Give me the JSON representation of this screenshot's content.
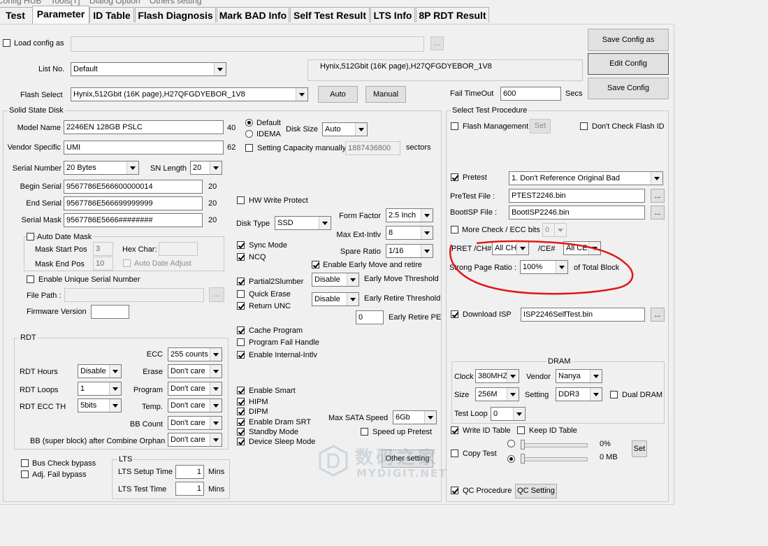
{
  "menubar": {
    "items": [
      "Config HUB",
      "Tools[T]",
      "Dialog Option",
      "Others setting"
    ]
  },
  "tabs": [
    "Test",
    "Parameter",
    "ID Table",
    "Flash Diagnosis",
    "Mark BAD Info",
    "Self Test Result",
    "LTS Info",
    "8P RDT Result"
  ],
  "top": {
    "load_config_label": "Load config as",
    "load_config_path": "",
    "browse_label": "...",
    "list_no_label": "List No.",
    "list_no_value": "Default",
    "flash_info": "Hynix,512Gbit (16K page),H27QFGDYEBOR_1V8",
    "flash_select_label": "Flash Select",
    "flash_select_value": "Hynix,512Gbit (16K page),H27QFGDYEBOR_1V8",
    "auto_label": "Auto",
    "manual_label": "Manual",
    "save_config_as": "Save Config as",
    "edit_config": "Edit Config",
    "save_config": "Save Config",
    "fail_timeout_label": "Fail TimeOut",
    "fail_timeout_value": "600",
    "secs_label": "Secs"
  },
  "ssd": {
    "title": "Solid State Disk",
    "model_name_label": "Model Name",
    "model_name": "2246EN 128GB PSLC",
    "model_len": "40",
    "vendor_label": "Vendor Specific",
    "vendor": "UMI",
    "vendor_len": "62",
    "default_label": "Default",
    "idema_label": "IDEMA",
    "disk_size_label": "Disk Size",
    "disk_size": "Auto",
    "set_capacity_label": "Setting Capacity manually",
    "capacity": "1887436800",
    "sectors_label": "sectors",
    "serial_num_label": "Serial Number",
    "serial_num": "20 Bytes",
    "sn_length_label": "SN Length",
    "sn_length": "20",
    "begin_serial_label": "Begin Serial",
    "begin_serial": "9567786E566600000014",
    "begin_len": "20",
    "end_serial_label": "End Serial",
    "end_serial": "9567786E566699999999",
    "end_len": "20",
    "serial_mask_label": "Serial Mask",
    "serial_mask": "9567786E5666########",
    "mask_len": "20",
    "auto_date_mask_label": "Auto Date Mask",
    "mask_start_label": "Mask Start Pos",
    "mask_start": "3",
    "mask_end_label": "Mask End Pos",
    "mask_end": "10",
    "hex_char_label": "Hex Char:",
    "hex_char": "",
    "auto_date_adjust_label": "Auto Date Adjust",
    "unique_serial_label": "Enable Unique Serial Number",
    "file_path_label": "File Path :",
    "file_path": "",
    "firmware_label": "Firmware Version",
    "firmware": "",
    "hw_write_protect": "HW Write Protect",
    "disk_type_label": "Disk Type",
    "disk_type": "SSD",
    "form_factor_label": "Form Factor",
    "form_factor": "2.5 Inch",
    "max_ext_label": "Max Ext-Intlv",
    "max_ext": "8",
    "spare_ratio_label": "Spare Ratio",
    "spare_ratio": "1/16",
    "sync_mode": "Sync Mode",
    "ncq": "NCQ",
    "early_move_retire": "Enable Early Move and retire",
    "partial2slumber": "Partial2Slumber",
    "quick_erase": "Quick Erase",
    "return_unc": "Return UNC",
    "early_move_sel": "Disable",
    "early_move_label": "Early Move Threshold",
    "early_retire_sel": "Disable",
    "early_retire_label": "Early Retire Threshold",
    "early_retire_pe": "0",
    "early_retire_pe_label": "Early Retire PE",
    "cache_program": "Cache Program",
    "program_fail_handle": "Program Fail Handle",
    "enable_internal_intlv": "Enable Internal-Intlv",
    "enable_smart": "Enable Smart",
    "hipm": "HIPM",
    "dipm": "DIPM",
    "enable_dram_srt": "Enable Dram SRT",
    "standby_mode": "Standby Mode",
    "device_sleep_mode": "Device Sleep Mode",
    "max_sata_label": "Max SATA Speed",
    "max_sata": "6Gb",
    "speed_up_pretest": "Speed up Pretest",
    "other_setting": "Other setting"
  },
  "rdt": {
    "title": "RDT",
    "ecc_label": "ECC",
    "ecc": "255 counts",
    "hours_label": "RDT Hours",
    "hours": "Disable",
    "erase_label": "Erase",
    "erase": "Don't care",
    "loops_label": "RDT Loops",
    "loops": "1",
    "program_label": "Program",
    "program": "Don't care",
    "ecc_th_label": "RDT ECC TH",
    "ecc_th": "5bits",
    "temp_label": "Temp.",
    "temp": "Don't care",
    "bb_count_label": "BB Count",
    "bb_count": "Don't care",
    "bb_super_label": "BB (super block) after Combine Orphan",
    "bb_super": "Don't care"
  },
  "misc": {
    "bus_check_bypass": "Bus Check bypass",
    "adj_fail_bypass": "Adj. Fail bypass"
  },
  "lts": {
    "title": "LTS",
    "setup_label": "LTS Setup Time",
    "setup": "1",
    "test_label": "LTS Test Time",
    "test": "1",
    "mins": "Mins"
  },
  "procedure": {
    "title": "Select Test Procedure",
    "flash_mgmt": "Flash Management",
    "set_label": "Set",
    "dont_check_flash_id": "Don't Check Flash ID",
    "pretest": "Pretest",
    "pretest_mode": "1. Don't Reference Original Bad",
    "pretest_file_label": "PreTest File :",
    "pretest_file": "PTEST2246.bin",
    "bootisp_label": "BootISP File :",
    "bootisp": "BootISP2246.bin",
    "more_check": "More Check / ECC bits",
    "more_check_val": "0",
    "pret_ch_label": "PRET /CH#",
    "pret_ch": "All CH",
    "ce_label": "/CE#",
    "ce": "All CE",
    "strong_ratio_label": "Strong Page Ratio :",
    "strong_ratio": "100%",
    "of_total_block": "of Total Block",
    "download_isp": "Download ISP",
    "isp_file": "ISP2246SelfTest.bin",
    "dram_title": "DRAM",
    "clock_label": "Clock",
    "clock": "380MHZ",
    "vendor_label": "Vendor",
    "vendor": "Nanya",
    "size_label": "Size",
    "size": "256M",
    "setting_label": "Setting",
    "setting": "DDR3",
    "dual_dram": "Dual DRAM",
    "test_loop_label": "Test Loop",
    "test_loop": "0",
    "write_id_table": "Write ID Table",
    "keep_id_table": "Keep ID Table",
    "copy_test": "Copy Test",
    "pct": "0%",
    "mb": "0 MB",
    "set_btn": "Set",
    "qc_procedure": "QC Procedure",
    "qc_setting": "QC Setting"
  },
  "watermark": {
    "text_cn": "数码之家",
    "text_en": "MYDIGIT.NET"
  },
  "colors": {
    "annotation": "#e01818",
    "window": "#f0f0f0"
  }
}
